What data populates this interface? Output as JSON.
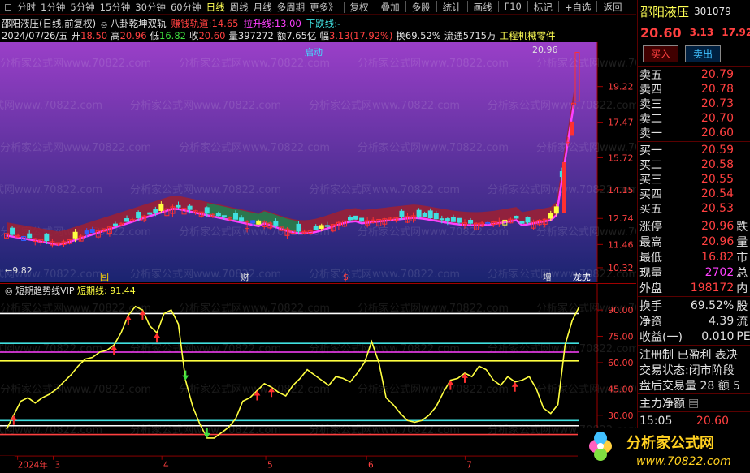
{
  "toolbar": {
    "items": [
      {
        "label": "分时",
        "active": false
      },
      {
        "label": "1分钟",
        "active": false
      },
      {
        "label": "5分钟",
        "active": false
      },
      {
        "label": "15分钟",
        "active": false
      },
      {
        "label": "30分钟",
        "active": false
      },
      {
        "label": "60分钟",
        "active": false
      },
      {
        "label": "日线",
        "active": true
      },
      {
        "label": "周线",
        "active": false
      },
      {
        "label": "月线",
        "active": false
      },
      {
        "label": "多周期",
        "active": false
      },
      {
        "label": "更多》",
        "active": false
      }
    ],
    "right_items": [
      "复权",
      "叠加",
      "多股",
      "统计",
      "画线",
      "F10",
      "标记",
      "+自选",
      "返回"
    ]
  },
  "header": {
    "title": "邵阳液压(日线,前复权)",
    "indicator_name": "八卦乾坤双轨",
    "ind1_label": "赚钱轨道:",
    "ind1_value": "14.65",
    "ind2_label": "拉升线:",
    "ind2_value": "13.00",
    "ind3_label": "下跌线:",
    "ind3_value": "-",
    "date": "2024/07/26/五",
    "open_label": "开",
    "open": "18.50",
    "high_label": "高",
    "high": "20.96",
    "low_label": "低",
    "low": "16.82",
    "close_label": "收",
    "close": "20.60",
    "vol_label": "量",
    "vol": "397272",
    "amt_label": "额",
    "amt": "7.65亿",
    "amp_label": "幅",
    "amp": "3.13(17.92%)",
    "turn_label": "换",
    "turn": "69.52%",
    "float_label": "流通",
    "float": "5715万",
    "industry": "工程机械零件"
  },
  "main_chart": {
    "y_ticks": [
      "19.22",
      "17.47",
      "15.72",
      "14.15",
      "12.74",
      "11.46",
      "10.32"
    ],
    "high_marker": "20.96",
    "low_marker": "9.82",
    "start_label": "启动",
    "markers": [
      {
        "text": "回",
        "color": "#ffd700"
      },
      {
        "text": "财",
        "color": "#e0e0e0"
      },
      {
        "text": "$",
        "color": "#ff4040"
      },
      {
        "text": "增",
        "color": "#e0e0e0"
      },
      {
        "text": "龙虎",
        "color": "#ffffff"
      }
    ],
    "watermark": "分析家公式网www.70822.com"
  },
  "indicator": {
    "name": "短期趋势线VIP",
    "line_label": "短期线:",
    "line_value": "91.44",
    "y_ticks": [
      "90.00",
      "75.00",
      "60.00",
      "45.00",
      "30.00",
      "15.00"
    ],
    "hlines": [
      {
        "level": 88,
        "color": "#ffffff"
      },
      {
        "level": 71,
        "color": "#40e0e0"
      },
      {
        "level": 66,
        "color": "#ff40ff"
      },
      {
        "level": 61,
        "color": "#ffff40"
      },
      {
        "level": 27,
        "color": "#40e0e0"
      },
      {
        "level": 24,
        "color": "#ffffff"
      },
      {
        "level": 19,
        "color": "#ff4040"
      }
    ],
    "series": [
      22,
      30,
      38,
      40,
      37,
      40,
      42,
      45,
      49,
      53,
      58,
      62,
      63,
      66,
      67,
      70,
      77,
      87,
      92,
      90,
      81,
      77,
      88,
      90,
      82,
      50,
      35,
      25,
      17,
      17,
      20,
      23,
      28,
      38,
      40,
      44,
      48,
      46,
      43,
      41,
      47,
      51,
      56,
      53,
      50,
      47,
      52,
      51,
      49,
      54,
      60,
      72,
      60,
      40,
      36,
      31,
      27,
      26,
      27,
      30,
      35,
      43,
      50,
      51,
      54,
      52,
      58,
      56,
      50,
      47,
      52,
      49,
      50,
      52,
      45,
      34,
      31,
      36,
      70,
      84,
      92
    ]
  },
  "x_axis": {
    "labels": [
      "2024年",
      "3",
      "4",
      "5",
      "6",
      "7"
    ]
  },
  "quote": {
    "name": "邵阳液压",
    "code": "301079",
    "price": "20.60",
    "change": "3.13",
    "pct": "17.92",
    "buy_btn": "买入",
    "sell_btn": "卖出",
    "asks": [
      {
        "label": "卖五",
        "price": "20.79"
      },
      {
        "label": "卖四",
        "price": "20.78"
      },
      {
        "label": "卖三",
        "price": "20.73"
      },
      {
        "label": "卖二",
        "price": "20.70"
      },
      {
        "label": "卖一",
        "price": "20.60"
      }
    ],
    "bids": [
      {
        "label": "买一",
        "price": "20.59"
      },
      {
        "label": "买二",
        "price": "20.58"
      },
      {
        "label": "买三",
        "price": "20.55"
      },
      {
        "label": "买四",
        "price": "20.54"
      },
      {
        "label": "买五",
        "price": "20.53"
      }
    ],
    "stats1": [
      {
        "label": "涨停",
        "value": "20.96",
        "color": "#ff4040",
        "tail": "跌"
      },
      {
        "label": "最高",
        "value": "20.96",
        "color": "#ff4040",
        "tail": "量"
      },
      {
        "label": "最低",
        "value": "16.82",
        "color": "#ff4040",
        "tail": "市"
      },
      {
        "label": "现量",
        "value": "2702",
        "color": "#ff40ff",
        "tail": "总"
      },
      {
        "label": "外盘",
        "value": "198172",
        "color": "#ff4040",
        "tail": "内"
      }
    ],
    "stats2": [
      {
        "label": "换手",
        "value": "69.52%",
        "color": "#e0e0e0",
        "tail": "股"
      },
      {
        "label": "净资",
        "value": "4.39",
        "color": "#e0e0e0",
        "tail": "流"
      },
      {
        "label": "收益(一)",
        "value": "0.010",
        "color": "#e0e0e0",
        "tail": "PE"
      }
    ],
    "notes": [
      "注册制 已盈利 表决",
      "交易状态:闭市阶段",
      "盘后交易量 28 额 5"
    ],
    "main_flow": "主力净额",
    "time": "15:05",
    "last": "20.60"
  },
  "logo": {
    "text": "分析家公式网",
    "url": "www.70822.com"
  },
  "colors": {
    "up": "#ff4040",
    "down": "#40e0e0",
    "yellow": "#ffff54",
    "bg": "#000000",
    "chart_top": "#9040c0",
    "chart_bottom": "#202878"
  }
}
